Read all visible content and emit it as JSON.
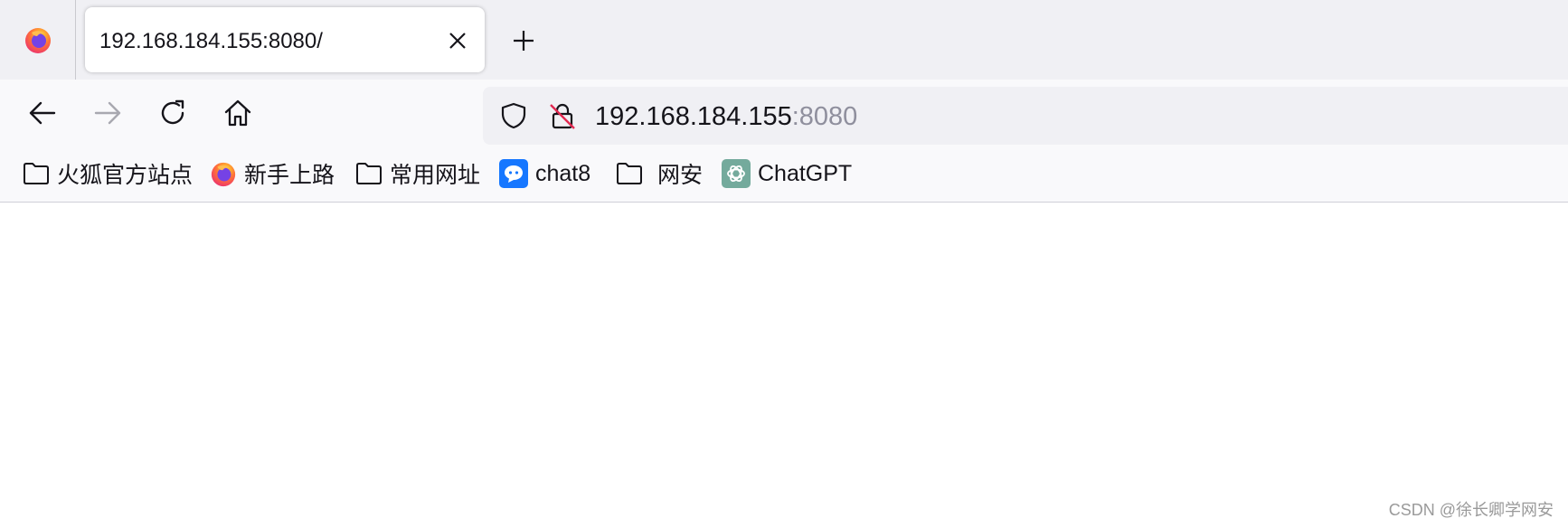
{
  "tab": {
    "title": "192.168.184.155:8080/"
  },
  "urlbar": {
    "host": "192.168.184.155",
    "port": ":8080"
  },
  "bookmarks": [
    {
      "label": "火狐官方站点",
      "icon": "folder-icon"
    },
    {
      "label": "新手上路",
      "icon": "firefox-icon"
    },
    {
      "label": "常用网址",
      "icon": "folder-icon"
    },
    {
      "label": "chat8",
      "icon": "chat-bubble-icon"
    },
    {
      "label": "网安",
      "icon": "folder-icon"
    },
    {
      "label": "ChatGPT",
      "icon": "openai-icon"
    }
  ],
  "watermark": "CSDN @徐长卿学网安",
  "colors": {
    "tabstrip": "#f0f0f4",
    "toolbar": "#f9f9fb",
    "urlbar": "#f0f0f4",
    "chat8_brand": "#1677ff",
    "chatgpt_brand": "#74aa9c",
    "insecure_slash": "#e22850"
  }
}
